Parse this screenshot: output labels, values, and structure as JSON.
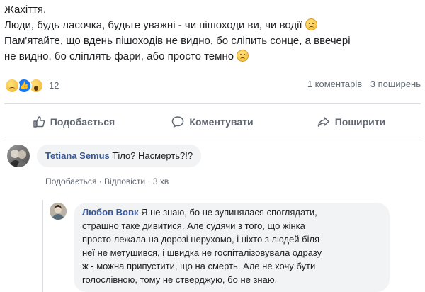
{
  "post": {
    "line1": "Жахіття.",
    "line2": "Люди, будь ласочка, будьте уважні - чи пішоходи ви, чи водії",
    "line3": "Пам'ятайте, що вдень пішоходів не видно, бо сліпить сонце, а ввечері",
    "line4": "не видно, бо сліплять фари, або просто темно"
  },
  "stats": {
    "reaction_count": "12",
    "comments": "1 коментарів",
    "shares": "3 поширень"
  },
  "actions": {
    "like": "Подобається",
    "comment": "Коментувати",
    "share": "Поширити"
  },
  "comments": [
    {
      "author": "Tetiana Semus",
      "text": "Тіло? Насмерть?!?",
      "like_label": "Подобається",
      "reply_label": "Відповісти",
      "dot": "·",
      "time": "3 хв"
    }
  ],
  "reply": {
    "author": "Любов Вовк",
    "line1": "Я не знаю, бо не зупинялася споглядати,",
    "line2": "страшно таке дивитися. Але судячи з того, що жінка",
    "line3": "просто лежала на дорозі нерухомо, і ніхто з людей біля",
    "line4": "неї не метушився, і швидка не госпіталізовувала одразу",
    "line5": "ж - можна припустити, що на смерть. Але не хочу бути",
    "line6": "голослівною, тому не стверджую, бо не знаю."
  },
  "colors": {
    "link": "#385898",
    "muted": "#606770",
    "bubble": "#f2f3f5",
    "like_blue": "#1877f2"
  },
  "icons": [
    "sad-emoji-icon",
    "like-reaction-icon",
    "wow-reaction-icon",
    "thumbs-up-icon",
    "comment-icon",
    "share-icon"
  ]
}
